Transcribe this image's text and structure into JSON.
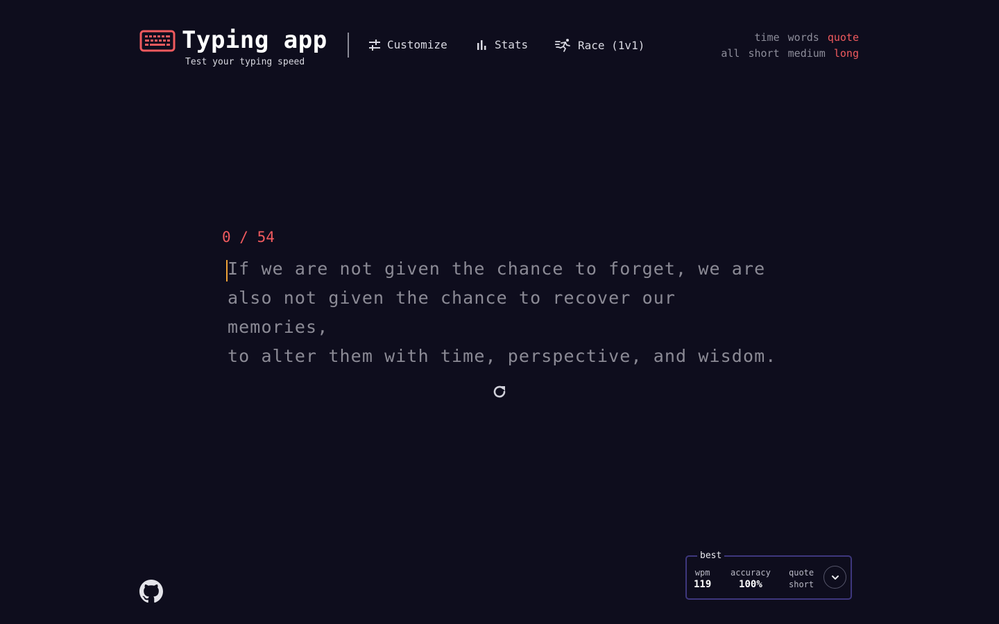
{
  "header": {
    "title": "Typing app",
    "subtitle": "Test your typing speed",
    "nav": {
      "customize": "Customize",
      "stats": "Stats",
      "race": "Race (1v1)"
    }
  },
  "modes": {
    "type": [
      "time",
      "words",
      "quote"
    ],
    "type_selected": "quote",
    "length": [
      "all",
      "short",
      "medium",
      "long"
    ],
    "length_selected": "long"
  },
  "test": {
    "progress": "0 / 54",
    "quote": "If we are not given the chance to forget, we are\nalso not given the chance to recover our memories,\nto alter them with time, perspective, and wisdom."
  },
  "best": {
    "legend": "best",
    "wpm_label": "wpm",
    "wpm": "119",
    "accuracy_label": "accuracy",
    "accuracy": "100%",
    "mode": "quote",
    "length": "short"
  },
  "icons": {
    "logo": "keyboard-icon",
    "customize": "sliders-icon",
    "stats": "bar-chart-icon",
    "race": "runner-icon",
    "restart": "refresh-icon",
    "github": "github-icon",
    "expand": "chevron-down-icon"
  },
  "colors": {
    "background": "#0e0d1d",
    "accent": "#f05a5e",
    "caret": "#f0a338",
    "text_pending": "#8b8a95",
    "box_border": "#3e377d"
  }
}
